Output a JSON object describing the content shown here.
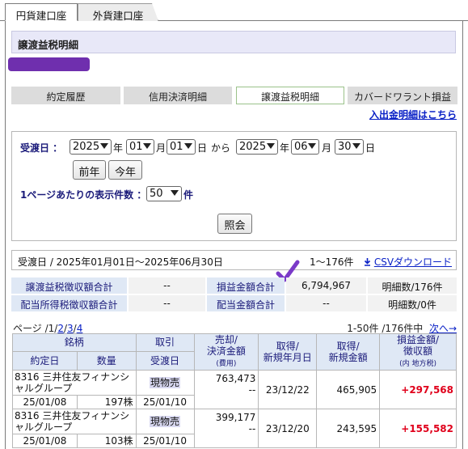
{
  "top_tabs": {
    "yen": "円貨建口座",
    "foreign": "外貨建口座"
  },
  "heading": "譲渡益税明細",
  "sub_tabs": [
    "約定履歴",
    "信用決済明細",
    "譲渡益税明細",
    "カバードワラント損益"
  ],
  "deposit_link": "入出金明細はこちら",
  "filter": {
    "date_label": "受渡日 ：",
    "from_year": "2025",
    "from_month": "01",
    "from_day": "01",
    "year_unit": "年",
    "month_unit": "月",
    "day_unit": "日",
    "kara": "から",
    "to_year": "2025",
    "to_month": "06",
    "to_day": "30",
    "prev_year_button": "前年",
    "this_year_button": "今年",
    "per_page_label": "1ページあたりの表示件数 ：",
    "per_page_value": "50",
    "per_page_unit": "件",
    "query_button": "照会"
  },
  "summary": {
    "range_text": "受渡日 / 2025年01月01日〜2025年06月30日",
    "count_text": "1〜176件",
    "csv_link": "CSVダウンロード"
  },
  "totals": {
    "row1": {
      "label1": "譲渡益税徴収額合計",
      "value1": "--",
      "label2": "損益金額合計",
      "value2": "6,794,967",
      "count": "明細数/176件"
    },
    "row2": {
      "label1": "配当所得税徴収額合計",
      "value1": "--",
      "label2": "配当金額合計",
      "value2": "--",
      "count": "明細数/0件"
    }
  },
  "pager": {
    "prefix": "ページ /",
    "pages": [
      "1",
      "2",
      "3",
      "4"
    ],
    "range_text": "1-50件 /176件中",
    "next": "次へ→"
  },
  "table": {
    "headers": {
      "security": "銘柄",
      "trade": "取引",
      "sale": "売却/",
      "sale2": "決済金額",
      "sale_sub": "(費用)",
      "acq_date": "取得/",
      "acq_date2": "新規年月日",
      "acq_amount": "取得/",
      "acq_amount2": "新規金額",
      "pl": "損益金額/",
      "pl2": "徴収額",
      "pl_sub": "(内 地方税)",
      "contract_date": "約定日",
      "quantity": "数量",
      "delivery_date": "受渡日"
    },
    "rows": [
      {
        "name": "8316 三井住友フィナンシャルグループ",
        "kind": "現物売",
        "sale": "763,473",
        "cost": "--",
        "acq_date": "23/12/22",
        "acq_amount": "465,905",
        "pl": "+297,568",
        "contract": "25/01/08",
        "qty": "197株",
        "delivery": "25/01/10"
      },
      {
        "name": "8316 三井住友フィナンシャルグループ",
        "kind": "現物売",
        "sale": "399,177",
        "cost": "--",
        "acq_date": "23/12/20",
        "acq_amount": "243,595",
        "pl": "+155,582",
        "contract": "25/01/08",
        "qty": "103株",
        "delivery": "25/01/10"
      }
    ]
  },
  "colors": {
    "accent_link": "#0a21c6",
    "profit": "#e0001b",
    "redaction": "#6f2fae",
    "header_bg": "#dfe8f5"
  },
  "icons": {
    "checkmark": "check-icon",
    "download": "download-icon"
  }
}
